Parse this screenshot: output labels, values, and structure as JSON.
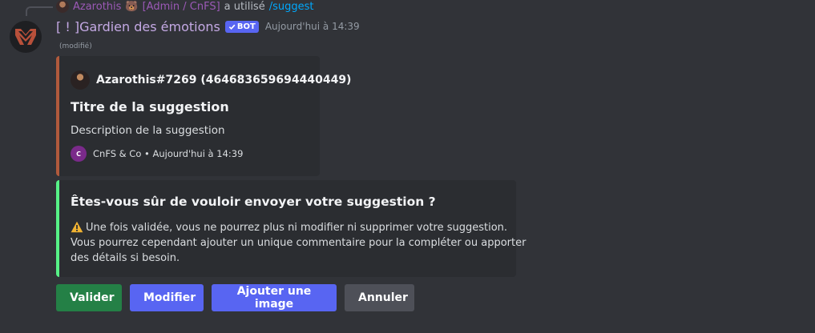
{
  "interaction": {
    "user_name": "Azarothis",
    "user_emoji": "🐻",
    "user_role": "[Admin / CnFS]",
    "action_text": "a utilisé",
    "command": "/suggest"
  },
  "message": {
    "author_name": "[ ! ]Gardien des émotions",
    "bot_badge_label": "BOT",
    "timestamp": "Aujourd'hui à 14:39",
    "edited_label": "(modifié)"
  },
  "suggestion_embed": {
    "author": "Azarothis#7269 (464683659694440449)",
    "title": "Titre de la suggestion",
    "description": "Description de la suggestion",
    "footer_icon_text": "C",
    "footer_text": "CnFS & Co • Aujourd'hui à 14:39",
    "accent_color": "#b05a3c"
  },
  "confirm_embed": {
    "title": "Êtes-vous sûr de vouloir envoyer votre suggestion ?",
    "line1": "Une fois validée, vous ne pourrez plus ni modifier ni supprimer votre suggestion.",
    "line2": "Vous pourrez cependant ajouter un unique commentaire pour la compléter ou apporter",
    "line3": "des détails si besoin.",
    "accent_color": "#57f287"
  },
  "buttons": {
    "validate": "Valider",
    "modify": "Modifier",
    "add_image": "Ajouter une image",
    "cancel": "Annuler"
  },
  "icons": {
    "bot_avatar": "guardian-logo-icon",
    "warning": "warning-icon",
    "verified": "checkmark-icon"
  }
}
